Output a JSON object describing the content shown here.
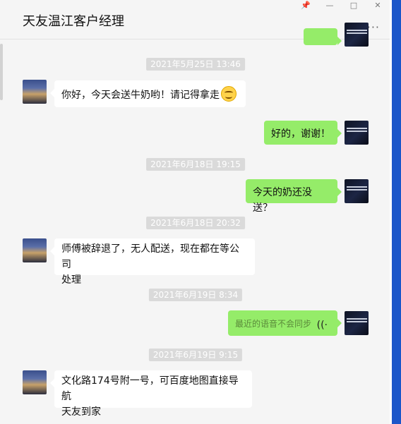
{
  "chat": {
    "title": "天友温江客户经理",
    "more": "···",
    "window_controls": {
      "pin": "📌",
      "minimize": "—",
      "maximize": "□",
      "close": "✕"
    }
  },
  "messages": [
    {
      "type": "timestamp",
      "text": "2021年5月25日 13:46"
    },
    {
      "type": "message",
      "side": "left",
      "text": "你好，今天会送牛奶哟！请记得拿走",
      "emoji": "smile-emoji"
    },
    {
      "type": "message",
      "side": "right",
      "text": "好的，谢谢！"
    },
    {
      "type": "timestamp",
      "text": "2021年6月18日 19:15"
    },
    {
      "type": "message",
      "side": "right",
      "text": "今天的奶还没送？"
    },
    {
      "type": "timestamp",
      "text": "2021年6月18日 20:32"
    },
    {
      "type": "message",
      "side": "left",
      "line1": "师傅被辞退了，无人配送，现在都在等公司",
      "line2": "处理"
    },
    {
      "type": "timestamp",
      "text": "2021年6月19日 8:34"
    },
    {
      "type": "voice",
      "side": "right",
      "text": "最近的语音不会同步",
      "icon": "voice-wave-icon"
    },
    {
      "type": "timestamp",
      "text": "2021年6月19日 9:15"
    },
    {
      "type": "message",
      "side": "left",
      "line1": "文化路174号附一号，可百度地图直接导航",
      "line2": "天友到家"
    }
  ],
  "colors": {
    "self_bubble": "#95ec69",
    "other_bubble": "#ffffff",
    "timestamp_bg": "#dadada",
    "background": "#f5f5f5",
    "accent_strip": "#1c56c9"
  }
}
